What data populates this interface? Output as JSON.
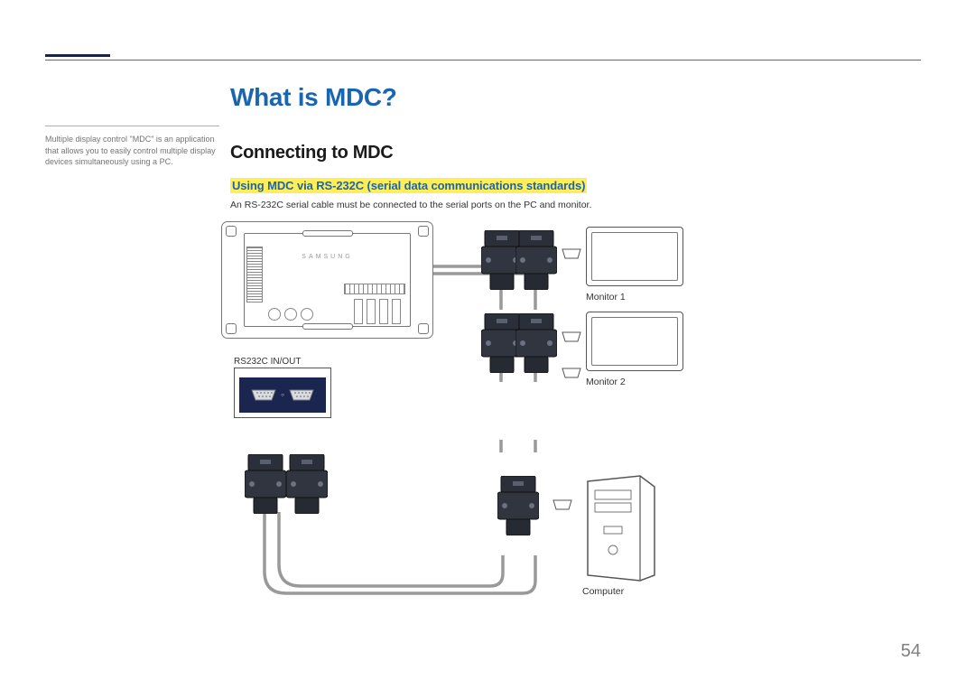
{
  "heading": "What is MDC?",
  "subheading": "Connecting to MDC",
  "highlight": "Using MDC via RS-232C (serial data communications standards)",
  "body": "An RS-232C serial cable must be connected to the serial ports on the PC and monitor.",
  "side_note": "Multiple display control \"MDC\" is an application that allows you to easily control multiple display devices simultaneously using a PC.",
  "diagram": {
    "panel_brand": "SAMSUNG",
    "closeup_label": "RS232C IN/OUT",
    "monitor1_label": "Monitor 1",
    "monitor2_label": "Monitor 2",
    "computer_label": "Computer"
  },
  "page_number": "54"
}
